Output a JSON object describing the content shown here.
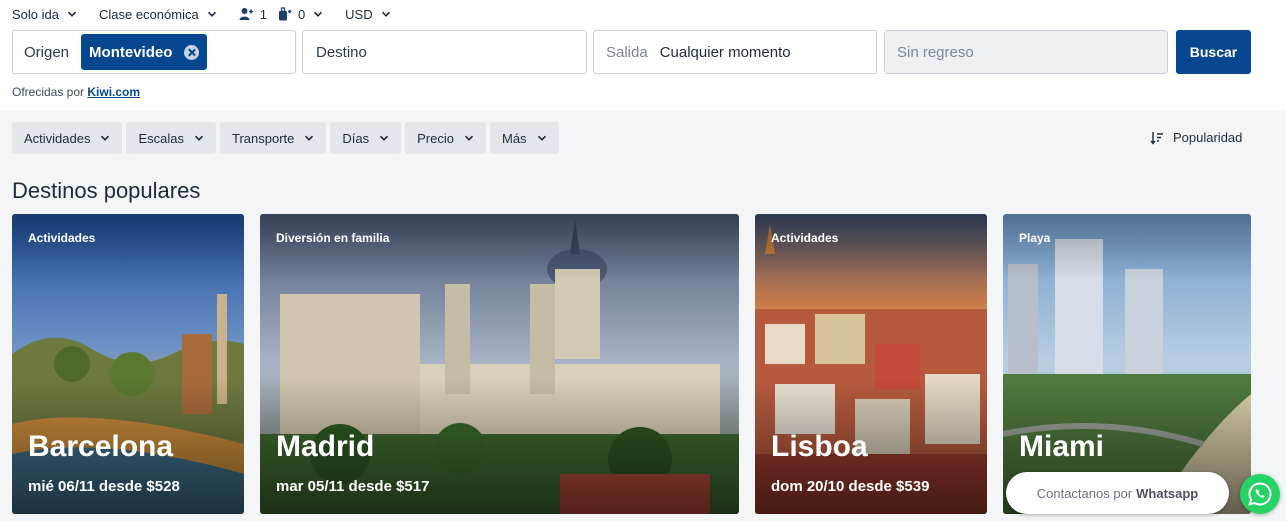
{
  "options": {
    "trip_type": "Solo ida",
    "cabin_class": "Clase económica",
    "passengers": "1",
    "bags": "0",
    "currency": "USD"
  },
  "search": {
    "origin_label": "Origen",
    "origin_value": "Montevideo",
    "destination_placeholder": "Destino",
    "departure_label": "Salida",
    "departure_value": "Cualquier momento",
    "return_placeholder": "Sin regreso",
    "button_label": "Buscar"
  },
  "powered_by": {
    "prefix": "Ofrecidas por",
    "link": "Kiwi.com"
  },
  "filters": [
    "Actividades",
    "Escalas",
    "Transporte",
    "Días",
    "Precio",
    "Más"
  ],
  "sort_label": "Popularidad",
  "section_title": "Destinos populares",
  "cards": [
    {
      "tag": "Actividades",
      "city": "Barcelona",
      "price": "mié 06/11 desde $528"
    },
    {
      "tag": "Diversión en familia",
      "city": "Madrid",
      "price": "mar 05/11 desde $517"
    },
    {
      "tag": "Actividades",
      "city": "Lisboa",
      "price": "dom 20/10 desde $539"
    },
    {
      "tag": "Playa",
      "city": "Miami",
      "price": ""
    }
  ],
  "whatsapp": {
    "prefix": "Contactanos por",
    "brand": "Whatsapp"
  },
  "icons": {
    "passengers": "passengers-icon",
    "bags": "bag-icon",
    "chevron": "chevron-down-icon",
    "sort": "sort-icon",
    "clear": "close-icon",
    "whatsapp": "whatsapp-icon"
  },
  "colors": {
    "brand": "#07478f",
    "whatsapp": "#25d366",
    "page_bg": "#f3f5f7"
  }
}
